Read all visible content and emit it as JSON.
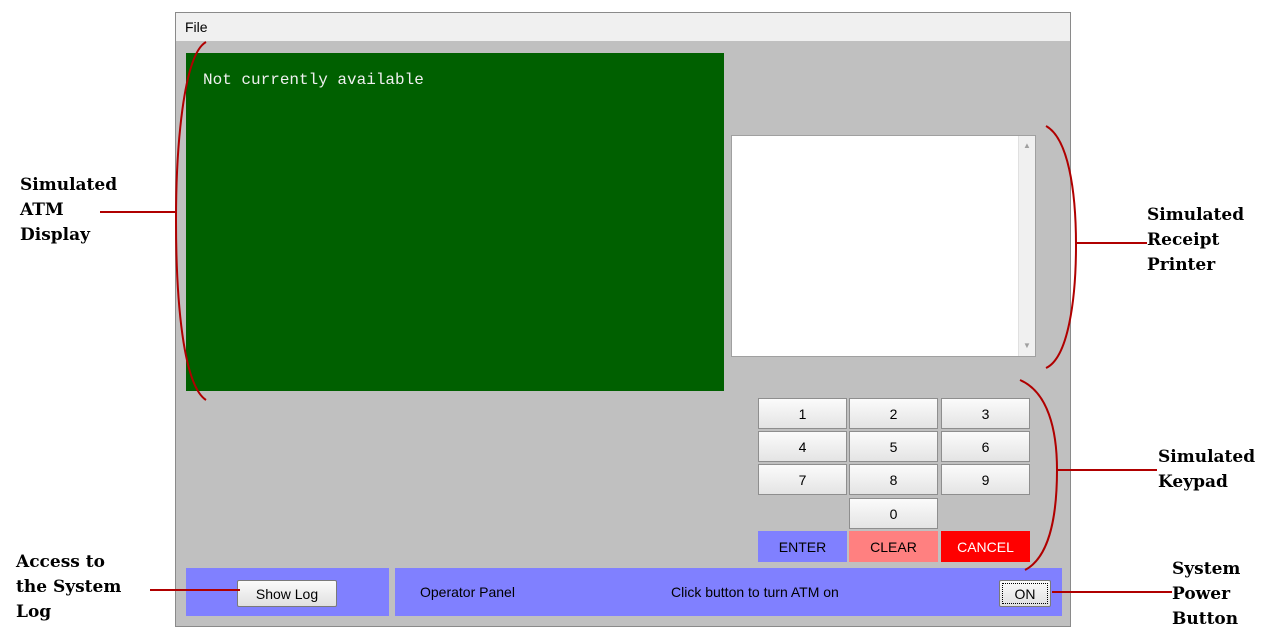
{
  "menu": {
    "file_label": "File"
  },
  "atm_display": {
    "text": "Not currently available",
    "color": "#006000"
  },
  "keypad": {
    "keys": [
      "1",
      "2",
      "3",
      "4",
      "5",
      "6",
      "7",
      "8",
      "9",
      "0"
    ],
    "enter_label": "ENTER",
    "clear_label": "CLEAR",
    "cancel_label": "CANCEL"
  },
  "log_panel": {
    "show_log_label": "Show Log"
  },
  "operator_panel": {
    "title": "Operator Panel",
    "status": "Click button to turn ATM on",
    "on_label": "ON"
  },
  "annotations": {
    "display": {
      "l1": "Simulated",
      "l2": "ATM",
      "l3": "Display"
    },
    "printer": {
      "l1": "Simulated",
      "l2": "Receipt",
      "l3": "Printer"
    },
    "keypad": {
      "l1": "Simulated",
      "l2": "Keypad"
    },
    "log": {
      "l1": "Access to",
      "l2": "the System",
      "l3": "Log"
    },
    "power": {
      "l1": "System",
      "l2": "Power",
      "l3": "Button"
    }
  },
  "colors": {
    "panel": "#8080ff",
    "annotation_line": "#b00000",
    "window_bg": "#c0c0c0"
  }
}
